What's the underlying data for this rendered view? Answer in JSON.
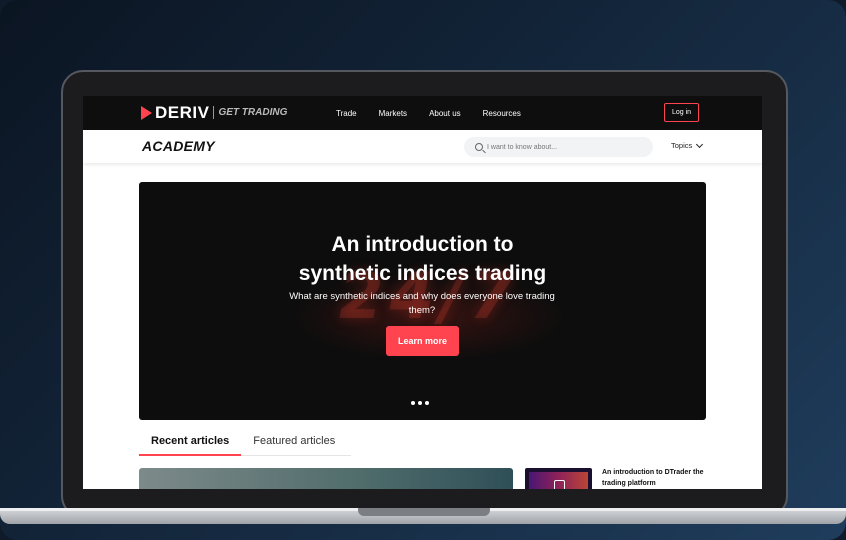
{
  "nav": {
    "logo_text": "DERIV",
    "logo_tagline": "GET TRADING",
    "links": [
      "Trade",
      "Markets",
      "About us",
      "Resources"
    ],
    "login_label": "Log in"
  },
  "academy": {
    "title": "ACADEMY",
    "search_placeholder": "I want to know about...",
    "topics_label": "Topics"
  },
  "hero": {
    "title_line1": "An introduction to",
    "title_line2": "synthetic indices trading",
    "subtitle": "What are synthetic indices and why does everyone love trading them?",
    "button_label": "Learn more",
    "background_text": "24/7",
    "slide_count": 3
  },
  "tabs": {
    "recent": "Recent articles",
    "featured": "Featured articles"
  },
  "articles": {
    "side_title": "An introduction to DTrader the trading platform"
  },
  "colors": {
    "brand": "#ff444f",
    "nav_bg": "#0e0e0e",
    "hero_bg": "#0d0d0d"
  }
}
